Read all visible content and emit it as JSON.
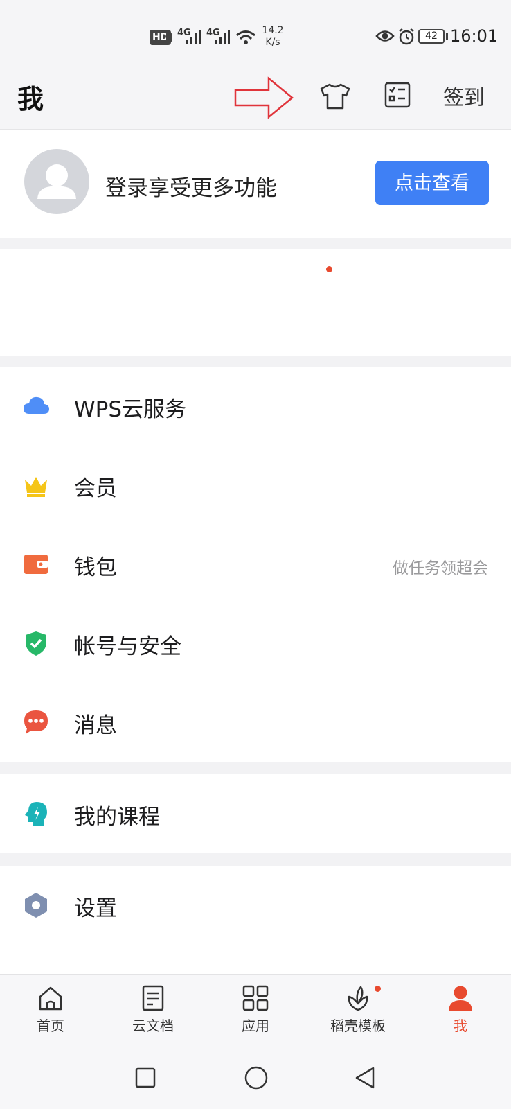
{
  "status_bar": {
    "hd_badge": "HD",
    "signal1_label": "4G",
    "signal2_label": "4G",
    "speed_value": "14.2",
    "speed_unit": "K/s",
    "battery": "42",
    "time": "16:01"
  },
  "header": {
    "title": "我",
    "checkin_label": "签到"
  },
  "profile": {
    "prompt": "登录享受更多功能",
    "button_label": "点击查看"
  },
  "menu_group_1": [
    {
      "label": "WPS云服务",
      "icon": "cloud-icon",
      "color": "#4f8ef7"
    },
    {
      "label": "会员",
      "icon": "crown-icon",
      "color": "#f5c518"
    },
    {
      "label": "钱包",
      "icon": "wallet-icon",
      "color": "#f06b3e",
      "hint": "做任务领超会"
    },
    {
      "label": "帐号与安全",
      "icon": "shield-icon",
      "color": "#27b868"
    },
    {
      "label": "消息",
      "icon": "chat-bubble-icon",
      "color": "#ea5540"
    }
  ],
  "menu_group_2": [
    {
      "label": "我的课程",
      "icon": "course-head-icon",
      "color": "#1bb3b8"
    }
  ],
  "menu_group_3": [
    {
      "label": "设置",
      "icon": "hexagon-settings-icon",
      "color": "#7f8fb0"
    }
  ],
  "bottom_nav": [
    {
      "label": "首页",
      "icon": "home-icon"
    },
    {
      "label": "云文档",
      "icon": "document-icon"
    },
    {
      "label": "应用",
      "icon": "apps-grid-icon"
    },
    {
      "label": "稻壳模板",
      "icon": "leaf-icon"
    },
    {
      "label": "我",
      "icon": "person-icon",
      "active": true
    }
  ],
  "colors": {
    "primary": "#3f80f5",
    "active_tab": "#e84a2f",
    "annotation_arrow": "#e0343b"
  }
}
